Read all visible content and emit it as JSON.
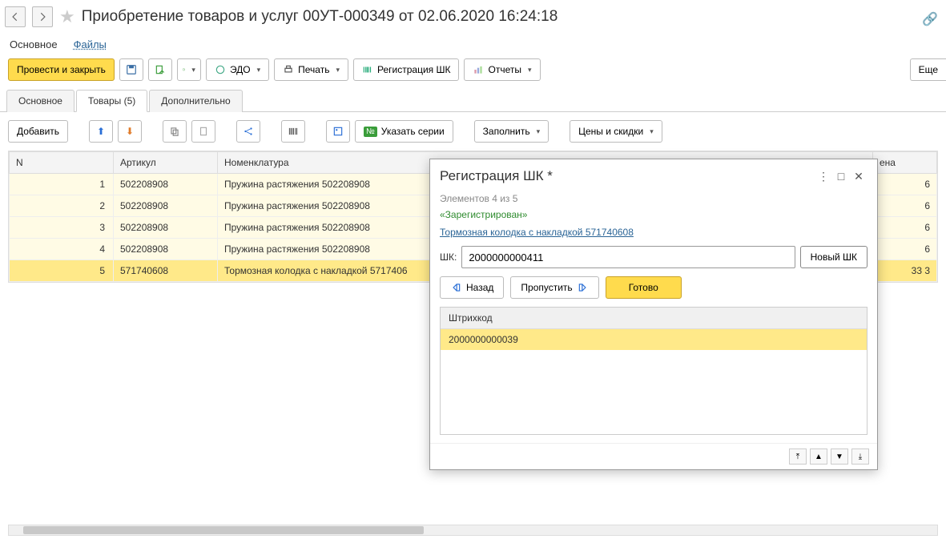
{
  "header": {
    "title": "Приобретение товаров и услуг 00УТ-000349 от 02.06.2020 16:24:18"
  },
  "sub_tabs": {
    "main": "Основное",
    "files": "Файлы"
  },
  "toolbar": {
    "save_close": "Провести и закрыть",
    "edo": "ЭДО",
    "print": "Печать",
    "reg_shk": "Регистрация ШК",
    "reports": "Отчеты",
    "more": "Еще"
  },
  "tabs": {
    "main": "Основное",
    "goods": "Товары (5)",
    "extra": "Дополнительно"
  },
  "toolbar2": {
    "add": "Добавить",
    "series": "Указать серии",
    "fill": "Заполнить",
    "prices": "Цены и скидки"
  },
  "table": {
    "headers": {
      "n": "N",
      "art": "Артикул",
      "nom": "Номенклатура",
      "price": "ена"
    },
    "rows": [
      {
        "n": "1",
        "art": "502208908",
        "nom": "Пружина растяжения 502208908",
        "price": "6"
      },
      {
        "n": "2",
        "art": "502208908",
        "nom": "Пружина растяжения 502208908",
        "price": "6"
      },
      {
        "n": "3",
        "art": "502208908",
        "nom": "Пружина растяжения 502208908",
        "price": "6"
      },
      {
        "n": "4",
        "art": "502208908",
        "nom": "Пружина растяжения 502208908",
        "price": "6"
      },
      {
        "n": "5",
        "art": "571740608",
        "nom": "Тормозная колодка с накладкой 5717406",
        "price": "33 3"
      }
    ]
  },
  "dialog": {
    "title": "Регистрация ШК *",
    "counter": "Элементов 4 из 5",
    "status": "«Зарегистрирован»",
    "link": "Тормозная колодка с накладкой 571740608",
    "shk_label": "ШК:",
    "shk_value": "2000000000411",
    "new_shk": "Новый ШК",
    "back": "Назад",
    "skip": "Пропустить",
    "done": "Готово",
    "col_barcode": "Штрихкод",
    "barcode": "2000000000039"
  }
}
